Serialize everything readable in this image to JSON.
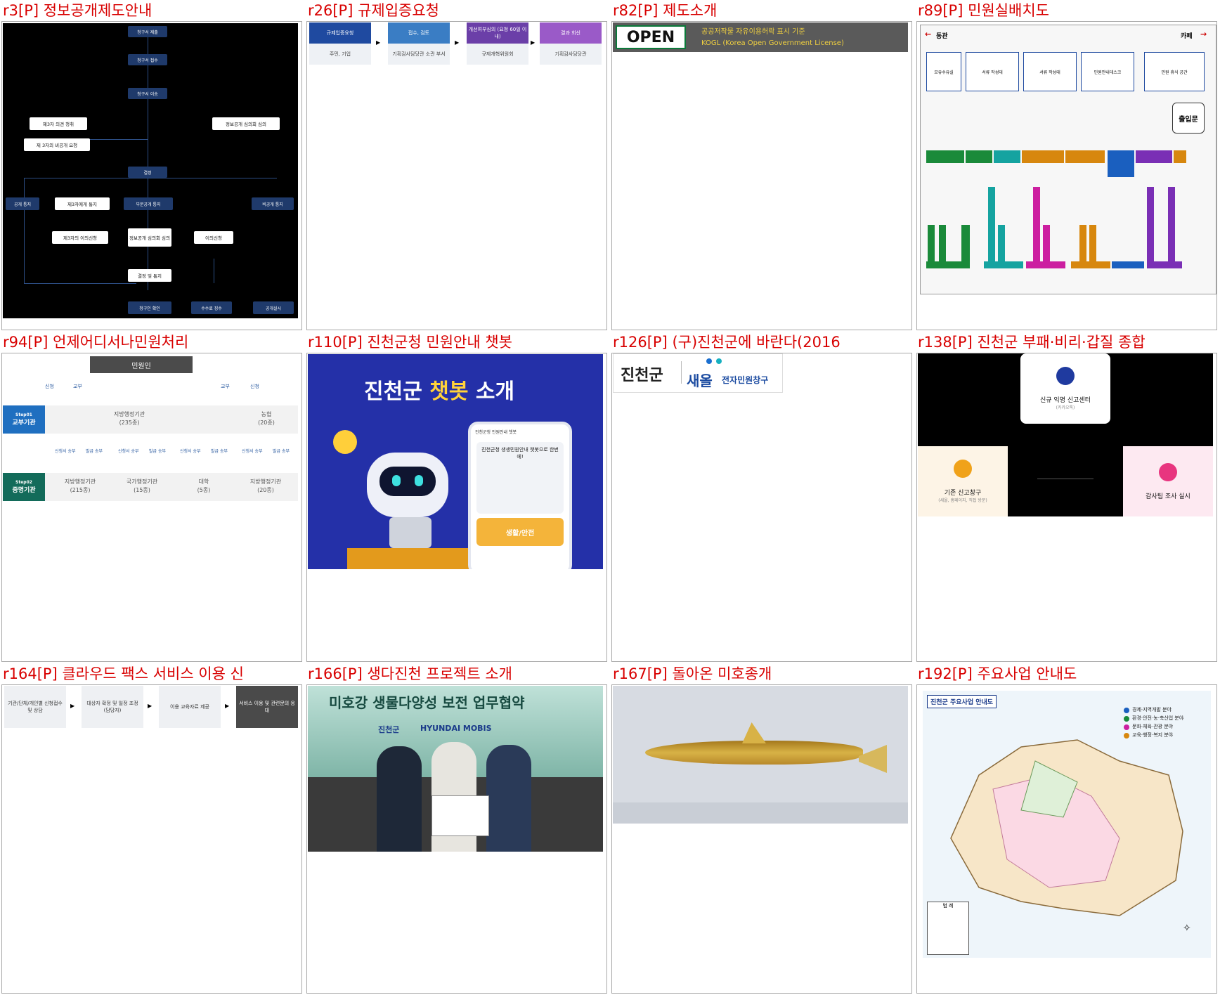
{
  "cells": [
    {
      "title": "r3[P] 정보공개제도안내"
    },
    {
      "title": "r26[P] 규제입증요청"
    },
    {
      "title": "r82[P] 제도소개"
    },
    {
      "title": "r89[P] 민원실배치도"
    },
    {
      "title": "r94[P] 언제어디서나민원처리"
    },
    {
      "title": "r110[P] 진천군청 민원안내 챗봇"
    },
    {
      "title": "r126[P] (구)진천군에 바란다(2016"
    },
    {
      "title": "r138[P] 진천군 부패·비리·갑질 종합"
    },
    {
      "title": "r164[P] 클라우드 팩스 서비스 이용 신"
    },
    {
      "title": "r166[P] 생다진천 프로젝트 소개"
    },
    {
      "title": "r167[P] 돌아온 미호종개"
    },
    {
      "title": "r192[P] 주요사업 안내도"
    }
  ],
  "r3": {
    "nodes": [
      "청구서 제출",
      "청구서 접수",
      "청구서 이송",
      "제3자 의견 청취",
      "정보공개 심의회 심의",
      "제 3자의 비공개 요청",
      "결정",
      "공개 통지",
      "제3자에게 통지",
      "부분공개 통지",
      "비공개 통지",
      "제3자의 이의신청",
      "정보공개 심의회 심의",
      "이의신청",
      "결정 및 통지",
      "청구인 확인",
      "수수료 징수",
      "공개실시"
    ]
  },
  "r26": {
    "steps": [
      "규제입증요청",
      "접수, 검토",
      "개선여부심의 (요청 60일 이내)",
      "결과 회신"
    ],
    "actors": [
      "주민, 기업",
      "기획감사담당관 소관 부서",
      "규제개혁위원회",
      "기획감사담당관"
    ]
  },
  "r82": {
    "logo": "OPEN",
    "line1": "공공저작물 자유이용허락 표시 기준",
    "line2": "KOGL (Korea Open Government License)"
  },
  "r89": {
    "left_label": "동관",
    "right_label": "카페",
    "top_boxes": [
      "모유수유실",
      "서류 작성대",
      "서류 작성대",
      "민원안내데스크",
      "민원 휴식 공간"
    ],
    "entrance": "출입문",
    "colors": {
      "green": "#1a8a3a",
      "teal": "#15a3a0",
      "orange": "#d7870e",
      "magenta": "#cc1fa0",
      "purple": "#7a2fb5",
      "blue": "#1a5fbf"
    }
  },
  "r94": {
    "top": "민원인",
    "arrows": [
      "신청",
      "교부",
      "교부",
      "신청"
    ],
    "step1_tag": "Step01",
    "step1_name": "교부기관",
    "step1_a": "지방행정기관",
    "step1_a_cnt": "(235종)",
    "step1_b": "농협",
    "step1_b_cnt": "(20종)",
    "mid_labels": [
      "신청서 송부",
      "발급 송부",
      "신청서 송부",
      "발급 송부",
      "신청서 송부",
      "발급 송부",
      "신청서 송부",
      "발급 송부"
    ],
    "step2_tag": "Step02",
    "step2_name": "증명기관",
    "step2_items": [
      [
        "지방행정기관",
        "(215종)"
      ],
      [
        "국가행정기관",
        "(15종)"
      ],
      [
        "대학",
        "(5종)"
      ],
      [
        "지방행정기관",
        "(20종)"
      ]
    ]
  },
  "r110": {
    "headline_a": "진천군",
    "headline_b": "챗봇",
    "headline_c": "소개",
    "phone_title": "진천군청 민원안내 챗봇",
    "bubble_title": "진천군청 생생민원안내 챗봇으로 한번에!",
    "card": "생활/안전"
  },
  "r126": {
    "brand": "진천군",
    "saeol": "새올",
    "saeol_sub": "전자민원창구"
  },
  "r138": {
    "top": "신규 익명 신고센터",
    "top_sub": "(카카오톡)",
    "left": "기존 신고창구",
    "left_sub": "(새올, 홈페이지, 직접 방문)",
    "right": "감사팀 조사 실시"
  },
  "r164": {
    "steps": [
      "기관/단체/개인별 신청접수 및 상담",
      "대상자 확정 및 일정 조정 (담당자)",
      "이용 교육자료 제공",
      "서비스 이용 및 관련문의 응대"
    ]
  },
  "r166": {
    "banner": "미호강 생물다양성 보전 업무협약",
    "logos": [
      "진천군",
      "HYUNDAI MOBIS"
    ]
  },
  "r192": {
    "map_title": "진천군 주요사업 안내도",
    "legend": [
      "경제·지역개발 분야",
      "환경·안전·농·축산업 분야",
      "문화·체육·관광 분야",
      "교육·행정·복지 분야"
    ],
    "legend_colors": [
      "#1a5fbf",
      "#1a8a3a",
      "#cc1fa0",
      "#d7870e"
    ],
    "footer": "범 례"
  }
}
